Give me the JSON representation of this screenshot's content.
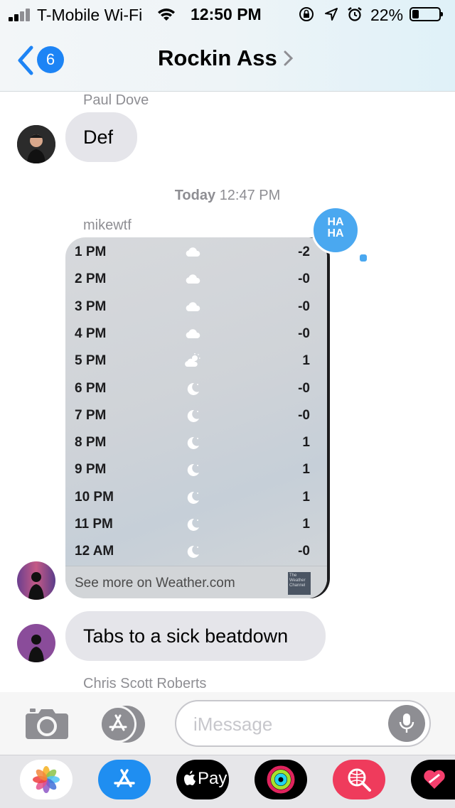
{
  "status_bar": {
    "carrier": "T-Mobile Wi-Fi",
    "time": "12:50 PM",
    "battery_percent": "22%",
    "battery_level": 0.22
  },
  "nav": {
    "back_count": "6",
    "title": "Rockin Ass",
    "chevron": "›"
  },
  "messages": {
    "paul": {
      "sender": "Paul Dove",
      "text": "Def"
    },
    "timestamp": {
      "day": "Today",
      "time": "12:47 PM"
    },
    "mike": {
      "sender": "mikewtf",
      "text2": "Tabs to a sick beatdown"
    },
    "chris": {
      "sender": "Chris Scott Roberts"
    }
  },
  "weather": {
    "rows": [
      {
        "hour": "1 PM",
        "icon": "cloud-icon",
        "value": "-2"
      },
      {
        "hour": "2 PM",
        "icon": "cloud-icon",
        "value": "-0"
      },
      {
        "hour": "3 PM",
        "icon": "cloud-icon",
        "value": "-0"
      },
      {
        "hour": "4 PM",
        "icon": "cloud-icon",
        "value": "-0"
      },
      {
        "hour": "5 PM",
        "icon": "partly-cloudy-icon",
        "value": "1"
      },
      {
        "hour": "6 PM",
        "icon": "moon-icon",
        "value": "-0"
      },
      {
        "hour": "7 PM",
        "icon": "moon-icon",
        "value": "-0"
      },
      {
        "hour": "8 PM",
        "icon": "moon-icon",
        "value": "1"
      },
      {
        "hour": "9 PM",
        "icon": "moon-icon",
        "value": "1"
      },
      {
        "hour": "10 PM",
        "icon": "moon-icon",
        "value": "1"
      },
      {
        "hour": "11 PM",
        "icon": "moon-icon",
        "value": "1"
      },
      {
        "hour": "12 AM",
        "icon": "moon-icon",
        "value": "-0"
      }
    ],
    "footer_link": "See more on Weather.com",
    "logo_text": "The Weather Channel"
  },
  "tapback": {
    "text": "HA HA"
  },
  "compose": {
    "placeholder": "iMessage",
    "camera_icon": "camera-icon",
    "appstore_icon": "app-store-icon",
    "mic_icon": "microphone-icon"
  },
  "dock": {
    "apple_pay_label": "Pay",
    "apps": [
      "photos-icon",
      "app-store-icon",
      "apple-pay-icon",
      "activity-icon",
      "web-search-icon",
      "heart-app-icon"
    ]
  },
  "colors": {
    "accent": "#1d84f5",
    "bubble_gray": "#e5e5ea",
    "secondary_text": "#8e8e93"
  }
}
